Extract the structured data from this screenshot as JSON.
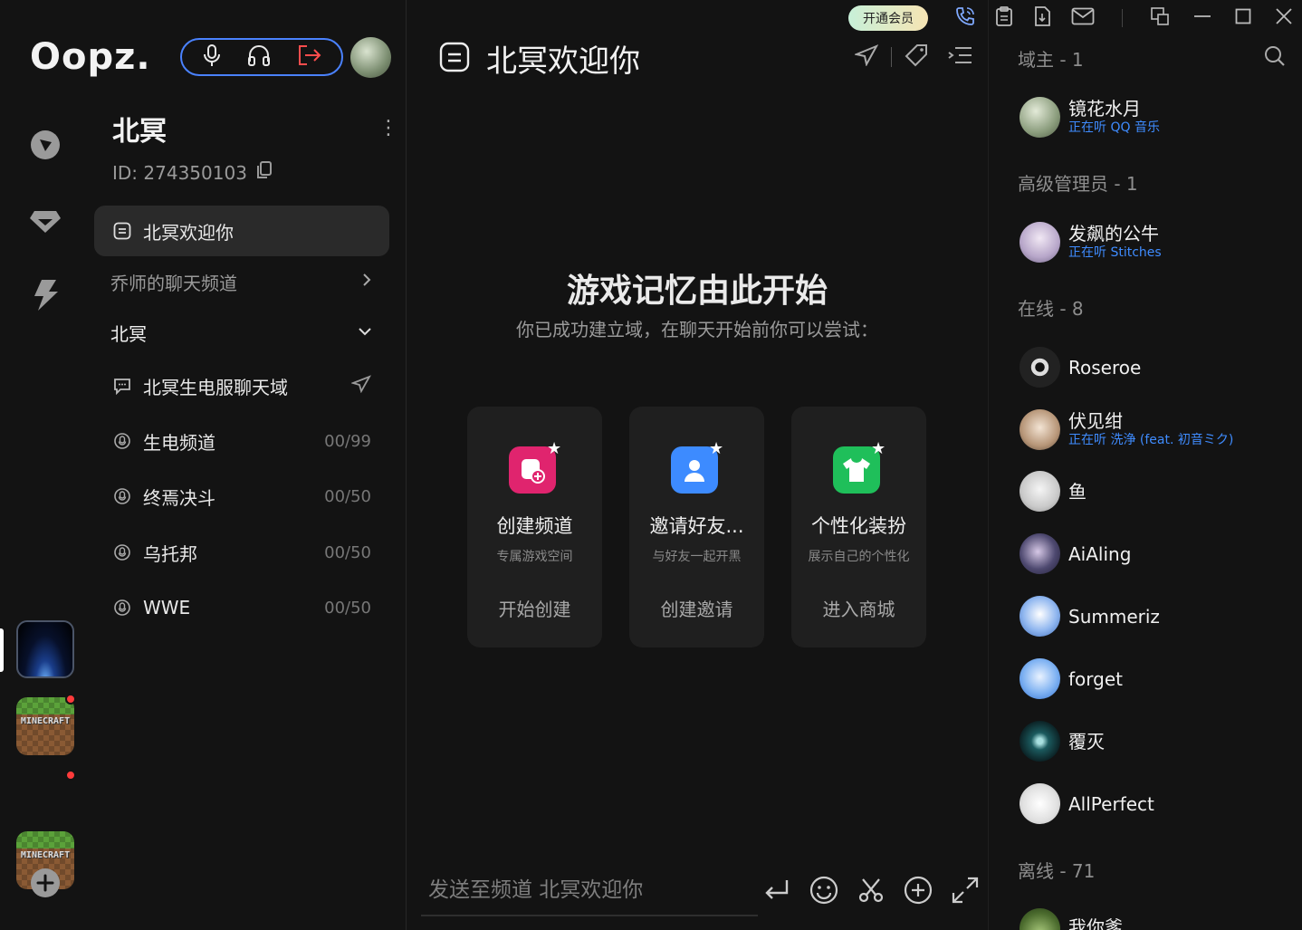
{
  "app": {
    "logo": "Oopz.",
    "vip_label": "开通会员"
  },
  "server": {
    "name": "北冥",
    "id_text": "ID: 274350103"
  },
  "channels": {
    "active": "北冥欢迎你",
    "group_collapsed": "乔师的聊天频道",
    "group_expanded": "北冥",
    "text_channel": "北冥生电服聊天域",
    "voice": [
      {
        "label": "生电频道",
        "count": "00/99"
      },
      {
        "label": "终焉决斗",
        "count": "00/50"
      },
      {
        "label": "乌托邦",
        "count": "00/50"
      },
      {
        "label": "WWE",
        "count": "00/50"
      }
    ]
  },
  "rail": {
    "server_thumbs": [
      {
        "name": "北冥 server",
        "label": ""
      },
      {
        "name": "minecraft server 1",
        "label": "MINECRAFT"
      },
      {
        "name": "minecraft server 2",
        "label": "MINECRAFT"
      }
    ]
  },
  "main": {
    "channel_title": "北冥欢迎你",
    "hero_title": "游戏记忆由此开始",
    "hero_subtitle": "你已成功建立域，在聊天开始前你可以尝试：",
    "cards": [
      {
        "title": "创建频道",
        "desc": "专属游戏空间",
        "action": "开始创建",
        "color": "#e0246e"
      },
      {
        "title": "邀请好友...",
        "desc": "与好友一起开黑",
        "action": "创建邀请",
        "color": "#3d8bff"
      },
      {
        "title": "个性化装扮",
        "desc": "展示自己的个性化",
        "action": "进入商城",
        "color": "#1fbf5a"
      }
    ],
    "composer_placeholder": "发送至频道 北冥欢迎你"
  },
  "members": {
    "owner_header": "域主 - 1",
    "admin_header": "高级管理员 - 1",
    "online_header": "在线 - 8",
    "offline_header": "离线 - 71",
    "owner": [
      {
        "name": "镜花水月",
        "status": "正在听 QQ 音乐"
      }
    ],
    "admin": [
      {
        "name": "发飙的公牛",
        "status": "正在听 Stitches"
      }
    ],
    "online": [
      {
        "name": "Roseroe",
        "status": ""
      },
      {
        "name": "伏见绀",
        "status": "正在听 洗浄 (feat. 初音ミク)"
      },
      {
        "name": "鱼",
        "status": ""
      },
      {
        "name": "AiAling",
        "status": ""
      },
      {
        "name": "Summeriz",
        "status": ""
      },
      {
        "name": "forget",
        "status": ""
      },
      {
        "name": "覆灭",
        "status": ""
      },
      {
        "name": "AllPerfect",
        "status": ""
      }
    ],
    "offline_partial": [
      {
        "name": "我你爹",
        "status": ""
      }
    ]
  },
  "colors": {
    "accent_blue": "#4a82ff",
    "status_blue": "#3f8cff",
    "danger_red": "#ff3b3b",
    "bg": "#131313",
    "card_bg": "#1f1f1f"
  }
}
